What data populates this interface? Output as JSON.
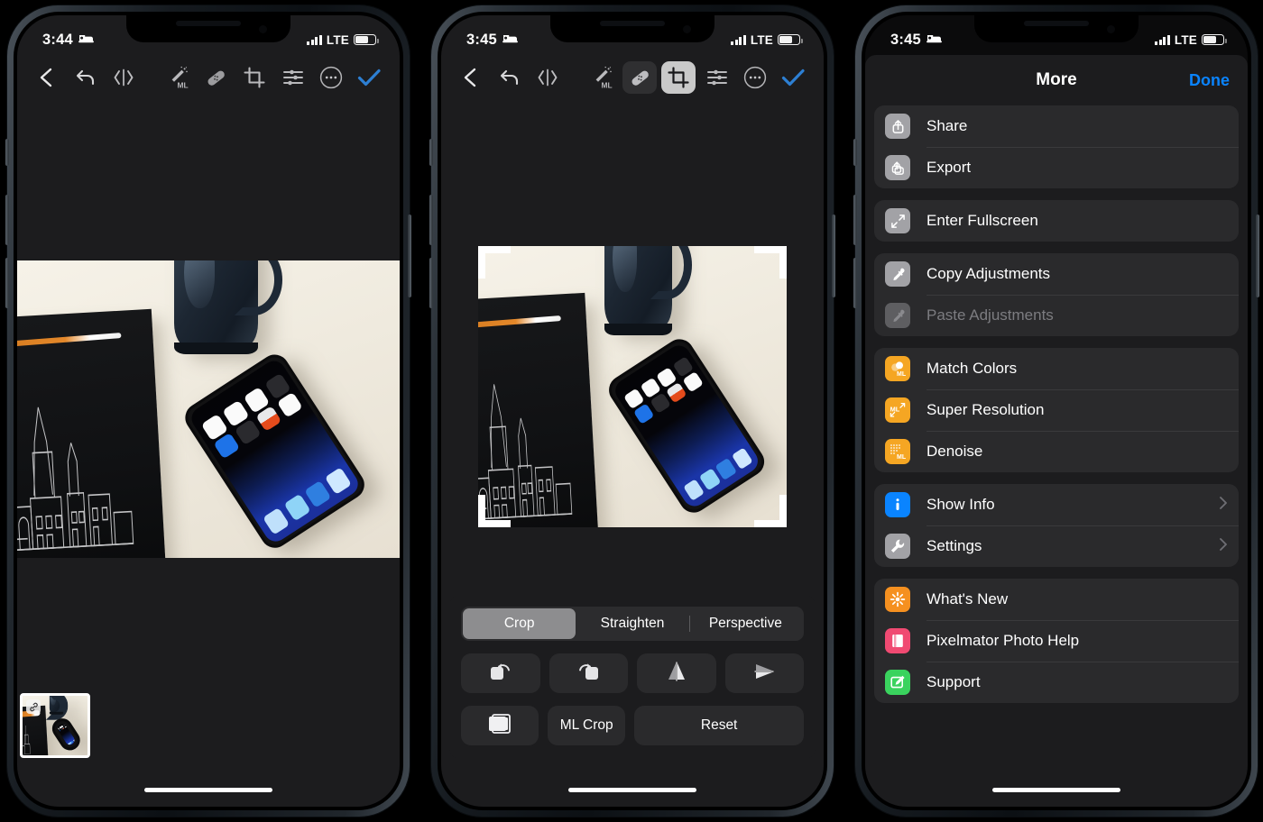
{
  "app": {
    "name": "Pixelmator Photo"
  },
  "phones": [
    {
      "id": "phone-1",
      "status": {
        "time": "3:44",
        "focus_icon": "sleep-focus-bed-icon",
        "network": "LTE",
        "signal_icon": "cellular-bars-icon",
        "battery_icon": "battery-icon"
      },
      "toolbar": {
        "items": [
          {
            "name": "back",
            "icon": "chevron-left-icon",
            "state": "normal"
          },
          {
            "name": "undo",
            "icon": "undo-arrow-icon",
            "state": "normal"
          },
          {
            "name": "compare",
            "icon": "before-after-compare-icon",
            "state": "normal"
          },
          {
            "name": "ml-enhance",
            "icon": "magic-wand-ml-icon",
            "state": "normal"
          },
          {
            "name": "repair",
            "icon": "bandage-repair-icon",
            "state": "normal"
          },
          {
            "name": "crop",
            "icon": "crop-icon",
            "state": "normal"
          },
          {
            "name": "adjustments",
            "icon": "sliders-adjust-icon",
            "state": "normal"
          },
          {
            "name": "more",
            "icon": "ellipsis-circle-icon",
            "state": "normal"
          },
          {
            "name": "done",
            "icon": "checkmark-icon",
            "state": "accent"
          }
        ],
        "accent_color": "#2d7fd3"
      },
      "thumbnail": {
        "badge_icon": "link-chain-icon"
      }
    },
    {
      "id": "phone-2",
      "status": {
        "time": "3:45",
        "focus_icon": "sleep-focus-bed-icon",
        "network": "LTE",
        "signal_icon": "cellular-bars-icon",
        "battery_icon": "battery-icon"
      },
      "toolbar": {
        "items": [
          {
            "name": "back",
            "icon": "chevron-left-icon",
            "state": "normal"
          },
          {
            "name": "undo",
            "icon": "undo-arrow-icon",
            "state": "normal"
          },
          {
            "name": "compare",
            "icon": "before-after-compare-icon",
            "state": "normal"
          },
          {
            "name": "ml-enhance",
            "icon": "magic-wand-ml-icon",
            "state": "normal"
          },
          {
            "name": "repair",
            "icon": "bandage-repair-icon",
            "state": "highlighted"
          },
          {
            "name": "crop",
            "icon": "crop-icon",
            "state": "selected"
          },
          {
            "name": "adjustments",
            "icon": "sliders-adjust-icon",
            "state": "normal"
          },
          {
            "name": "more",
            "icon": "ellipsis-circle-icon",
            "state": "normal"
          },
          {
            "name": "done",
            "icon": "checkmark-icon",
            "state": "accent"
          }
        ]
      },
      "crop_panel": {
        "segments": [
          {
            "label": "Crop",
            "selected": true
          },
          {
            "label": "Straighten",
            "selected": false
          },
          {
            "label": "Perspective",
            "selected": false
          }
        ],
        "transform_buttons": [
          {
            "label": "",
            "icon": "rotate-left-icon"
          },
          {
            "label": "",
            "icon": "rotate-right-icon"
          },
          {
            "label": "",
            "icon": "flip-horizontal-icon"
          },
          {
            "label": "",
            "icon": "flip-vertical-icon"
          }
        ],
        "action_buttons": [
          {
            "label": "",
            "icon": "aspect-ratio-icon"
          },
          {
            "label": "ML Crop",
            "icon": ""
          },
          {
            "label": "Reset",
            "icon": ""
          }
        ]
      }
    },
    {
      "id": "phone-3",
      "status": {
        "time": "3:45",
        "focus_icon": "sleep-focus-bed-icon",
        "network": "LTE",
        "signal_icon": "cellular-bars-icon",
        "battery_icon": "battery-icon"
      },
      "sheet": {
        "title": "More",
        "done_label": "Done",
        "done_color": "#0a84ff",
        "groups": [
          {
            "rows": [
              {
                "label": "Share",
                "icon": "share-upload-icon",
                "color": "grey",
                "disabled": false,
                "chevron": false
              },
              {
                "label": "Export",
                "icon": "export-stack-icon",
                "color": "grey",
                "disabled": false,
                "chevron": false
              }
            ]
          },
          {
            "rows": [
              {
                "label": "Enter Fullscreen",
                "icon": "expand-arrows-icon",
                "color": "grey",
                "disabled": false,
                "chevron": false
              }
            ]
          },
          {
            "rows": [
              {
                "label": "Copy Adjustments",
                "icon": "eyedropper-icon",
                "color": "grey",
                "disabled": false,
                "chevron": false
              },
              {
                "label": "Paste Adjustments",
                "icon": "eyedropper-icon",
                "color": "dim",
                "disabled": true,
                "chevron": false
              }
            ]
          },
          {
            "rows": [
              {
                "label": "Match Colors",
                "icon": "match-colors-ml-icon",
                "color": "amber",
                "disabled": false,
                "chevron": false
              },
              {
                "label": "Super Resolution",
                "icon": "super-resolution-ml-icon",
                "color": "amber",
                "disabled": false,
                "chevron": false
              },
              {
                "label": "Denoise",
                "icon": "denoise-ml-icon",
                "color": "amber",
                "disabled": false,
                "chevron": false
              }
            ]
          },
          {
            "rows": [
              {
                "label": "Show Info",
                "icon": "info-icon",
                "color": "blue",
                "disabled": false,
                "chevron": true
              },
              {
                "label": "Settings",
                "icon": "wrench-icon",
                "color": "grey",
                "disabled": false,
                "chevron": true
              }
            ]
          },
          {
            "rows": [
              {
                "label": "What's New",
                "icon": "sparkle-burst-icon",
                "color": "orange",
                "disabled": false,
                "chevron": false
              },
              {
                "label": "Pixelmator Photo Help",
                "icon": "book-help-icon",
                "color": "pink",
                "disabled": false,
                "chevron": false
              },
              {
                "label": "Support",
                "icon": "support-pencil-icon",
                "color": "green",
                "disabled": false,
                "chevron": false
              }
            ]
          }
        ]
      }
    }
  ]
}
